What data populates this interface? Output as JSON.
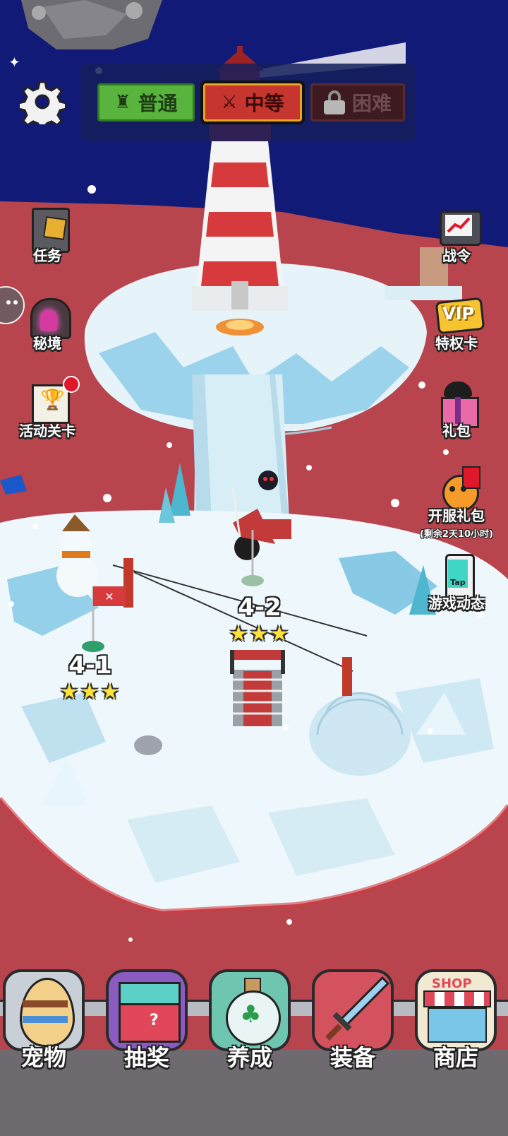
{
  "difficulty": {
    "normal_label": "普通",
    "medium_label": "中等",
    "hard_label": "困难",
    "selected": "中等"
  },
  "left_menu": [
    {
      "label": "任务",
      "icon": "book-icon"
    },
    {
      "label": "秘境",
      "icon": "cave-portal-icon"
    },
    {
      "label": "活动关卡",
      "icon": "trophy-card-icon",
      "badge": true
    }
  ],
  "right_menu": [
    {
      "label": "战令",
      "icon": "tv-chart-icon"
    },
    {
      "label": "特权卡",
      "icon": "vip-icon",
      "icon_text": "VIP"
    },
    {
      "label": "礼包",
      "icon": "gift-box-icon"
    },
    {
      "label": "开服礼包",
      "sub": "(剩余2天10小时)",
      "icon": "opening-gift-icon"
    },
    {
      "label": "游戏动态",
      "icon": "tap-phone-icon",
      "icon_text": "Tap"
    }
  ],
  "stages": [
    {
      "id": "4-1",
      "stars": "★★★",
      "stars_earned": 3
    },
    {
      "id": "4-2",
      "stars": "★★★",
      "stars_earned": 3
    }
  ],
  "bottom_nav": [
    {
      "label": "宠物",
      "icon": "egg-icon"
    },
    {
      "label": "抽奖",
      "icon": "lottery-box-icon"
    },
    {
      "label": "养成",
      "icon": "clover-bottle-icon"
    },
    {
      "label": "装备",
      "icon": "sword-icon"
    },
    {
      "label": "商店",
      "icon": "shop-icon",
      "icon_text": "SHOP"
    }
  ],
  "colors": {
    "sky": "#121a78",
    "ground": "#b8454d",
    "ice": "#eaf6fb",
    "ice_shadow": "#5cb6dd",
    "normal_tab": "#58b43c",
    "medium_tab": "#c6352e",
    "hard_tab": "#3d1a20",
    "star": "#ffe23b",
    "badge": "#e0182b"
  }
}
